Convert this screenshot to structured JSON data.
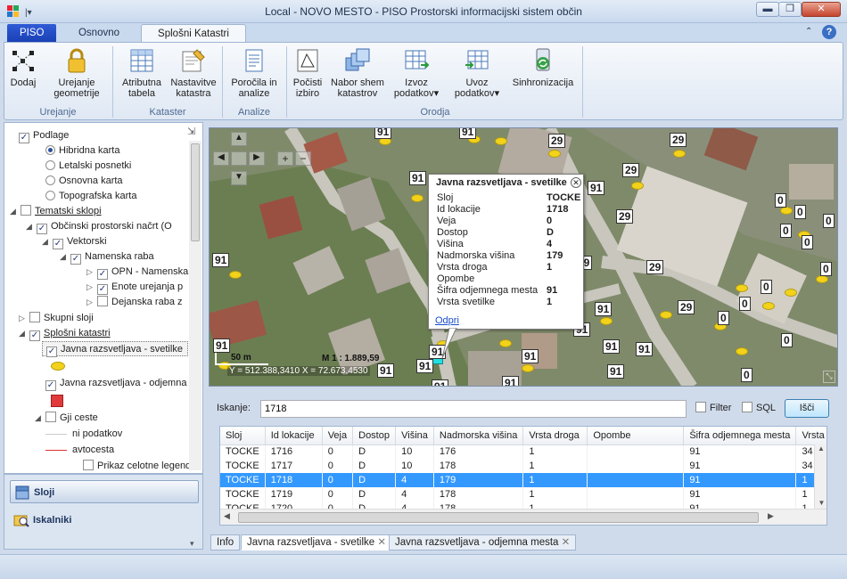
{
  "window": {
    "title": "Local - NOVO MESTO - PISO Prostorski informacijski sistem občin",
    "minimize": "▬",
    "maximize": "❐",
    "close": "✕"
  },
  "ribbon_tabs": [
    "PISO",
    "Osnovno",
    "Splošni Katastri"
  ],
  "ribbon": {
    "groups": [
      {
        "name": "Urejanje",
        "buttons": [
          "Dodaj",
          "Urejanje geometrije"
        ]
      },
      {
        "name": "Kataster",
        "buttons": [
          "Atributna tabela",
          "Nastavitve katastra"
        ]
      },
      {
        "name": "Analize",
        "buttons": [
          "Poročila in analize"
        ]
      },
      {
        "name": "Orodja",
        "buttons": [
          "Počisti izbiro",
          "Nabor shem katastrov",
          "Izvoz podatkov",
          "Uvoz podatkov",
          "Sinhronizacija"
        ]
      }
    ]
  },
  "tree": {
    "podlage": "Podlage",
    "hibridna": "Hibridna karta",
    "letalski": "Letalski posnetki",
    "osnovna": "Osnovna karta",
    "topografska": "Topografska karta",
    "tematski": "Tematski sklopi",
    "obcinski": "Občinski prostorski načrt (O",
    "vektorski": "Vektorski",
    "namenska": "Namenska raba",
    "opn": "OPN - Namenska",
    "enote": "Enote urejanja p",
    "dejanska": "Dejanska raba z",
    "skupni": "Skupni sloji",
    "splosni": "Splošni katastri",
    "javna_svet": "Javna razsvetljava - svetilke",
    "javna_odj": "Javna razsvetljava - odjemna",
    "gji": "Gji ceste",
    "ni_podatkov": "ni podatkov",
    "avtocesta": "avtocesta",
    "prikaz": "Prikaz celotne legende"
  },
  "nav": {
    "sloji": "Sloji",
    "iskalniki": "Iskalniki"
  },
  "map": {
    "scale_bar": "50 m",
    "scale": "M 1 : 1.889,59",
    "coords": "Y = 512.388,3410  X = 72.673,4530",
    "labels": [
      "91",
      "91",
      "29",
      "29",
      "29",
      "91",
      "29",
      "29",
      "0",
      "0",
      "0",
      "29",
      "29",
      "91",
      "0",
      "0",
      "0",
      "0",
      "0",
      "91",
      "91",
      "91",
      "91",
      "91",
      "0",
      "0",
      "0",
      "91",
      "91",
      "91",
      "91",
      "91",
      "91",
      "91",
      "91"
    ]
  },
  "popup": {
    "title": "Javna razsvetljava - svetilke",
    "rows": [
      {
        "k": "Sloj",
        "v": "TOCKE"
      },
      {
        "k": "Id lokacije",
        "v": "1718"
      },
      {
        "k": "Veja",
        "v": "0"
      },
      {
        "k": "Dostop",
        "v": "D"
      },
      {
        "k": "Višina",
        "v": "4"
      },
      {
        "k": "Nadmorska višina",
        "v": "179"
      },
      {
        "k": "Vrsta droga",
        "v": "1"
      },
      {
        "k": "Opombe",
        "v": ""
      },
      {
        "k": "Šifra odjemnega mesta",
        "v": "91"
      },
      {
        "k": "Vrsta svetilke",
        "v": "1"
      }
    ],
    "link": "Odpri"
  },
  "search": {
    "label": "Iskanje:",
    "value": "1718",
    "filter": "Filter",
    "sql": "SQL",
    "button": "Išči"
  },
  "grid": {
    "columns": [
      "Sloj",
      "Id lokacije",
      "Veja",
      "Dostop",
      "Višina",
      "Nadmorska višina",
      "Vrsta droga",
      "Opombe",
      "Šifra odjemnega mesta",
      "Vrsta"
    ],
    "rows": [
      [
        "TOCKE",
        "1716",
        "0",
        "D",
        "10",
        "176",
        "1",
        "",
        "91",
        "34"
      ],
      [
        "TOCKE",
        "1717",
        "0",
        "D",
        "10",
        "178",
        "1",
        "",
        "91",
        "34"
      ],
      [
        "TOCKE",
        "1718",
        "0",
        "D",
        "4",
        "179",
        "1",
        "",
        "91",
        "1"
      ],
      [
        "TOCKE",
        "1719",
        "0",
        "D",
        "4",
        "178",
        "1",
        "",
        "91",
        "1"
      ],
      [
        "TOCKE",
        "1720",
        "0",
        "D",
        "4",
        "178",
        "1",
        "",
        "91",
        "1"
      ]
    ],
    "selected_row": 2
  },
  "bottom_tabs": [
    "Info",
    "Javna razsvetljava - svetilke",
    "Javna razsvetljava - odjemna mesta"
  ],
  "colors": {
    "selection": "#3399ff",
    "legend_yellow": "#f2d21a",
    "legend_red": "#e03a3a",
    "piso_tab": "#1a3fb3"
  }
}
